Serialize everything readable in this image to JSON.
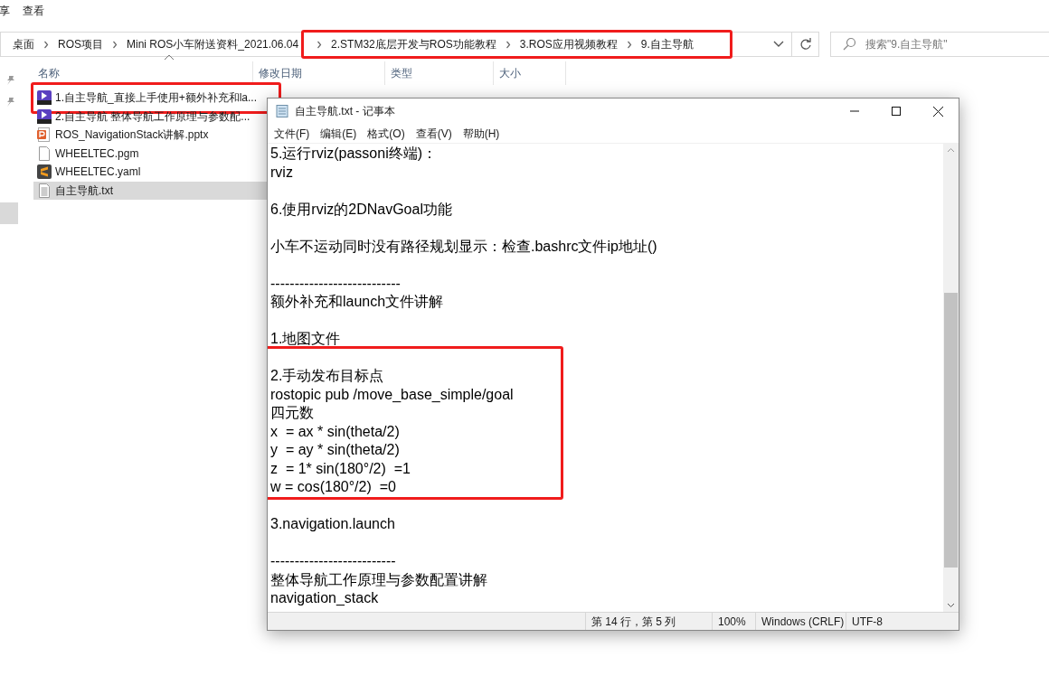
{
  "ribbon": {
    "tabs": [
      "享",
      "查看"
    ]
  },
  "address": {
    "crumb_groups": [
      {
        "highlighted": false,
        "crumbs": [
          "桌面",
          "ROS项目",
          "Mini ROS小车附送资料_2021.06.04"
        ]
      },
      {
        "highlighted": true,
        "crumbs": [
          "2.STM32底层开发与ROS功能教程",
          "3.ROS应用视频教程",
          "9.自主导航"
        ]
      }
    ],
    "search_placeholder": "搜索\"9.自主导航\""
  },
  "columns": [
    "名称",
    "修改日期",
    "类型",
    "大小"
  ],
  "files": [
    {
      "kind": "video",
      "name": "1.自主导航_直接上手使用+额外补充和la...",
      "selected": false,
      "highlighted": true
    },
    {
      "kind": "video",
      "name": "2.自主导航 整体导航工作原理与参数配...",
      "selected": false,
      "highlighted": false
    },
    {
      "kind": "slides",
      "name": "ROS_NavigationStack讲解.pptx",
      "selected": false,
      "highlighted": false
    },
    {
      "kind": "blank",
      "name": "WHEELTEC.pgm",
      "selected": false,
      "highlighted": false
    },
    {
      "kind": "sublime",
      "name": "WHEELTEC.yaml",
      "selected": false,
      "highlighted": false
    },
    {
      "kind": "text",
      "name": "自主导航.txt",
      "selected": true,
      "highlighted": false
    }
  ],
  "notepad": {
    "title": "自主导航.txt - 记事本",
    "menu": [
      "文件(F)",
      "编辑(E)",
      "格式(O)",
      "查看(V)",
      "帮助(H)"
    ],
    "blocks": [
      {
        "highlighted": false,
        "lines": [
          "5.运行rviz(passoni终端)：",
          "rviz"
        ]
      },
      {
        "highlighted": false,
        "lines": [
          "6.使用rviz的2DNavGoal功能"
        ]
      },
      {
        "highlighted": false,
        "lines": [
          "小车不运动同时没有路径规划显示：检查.bashrc文件ip地址()"
        ]
      },
      {
        "highlighted": false,
        "lines": [
          "---------------------------",
          "额外补充和launch文件讲解"
        ]
      },
      {
        "highlighted": false,
        "lines": [
          "1.地图文件"
        ]
      },
      {
        "highlighted": true,
        "lines": [
          "2.手动发布目标点",
          "rostopic pub /move_base_simple/goal",
          "四元数",
          "x  = ax * sin(theta/2)",
          "y  = ay * sin(theta/2)",
          "z  = 1* sin(180°/2)  =1",
          "w = cos(180°/2)  =0"
        ]
      },
      {
        "highlighted": false,
        "lines": [
          "3.navigation.launch"
        ]
      },
      {
        "highlighted": false,
        "lines": [
          "--------------------------",
          "整体导航工作原理与参数配置讲解",
          "navigation_stack"
        ]
      }
    ],
    "status": [
      "第 14 行，第 5 列",
      "100%",
      "Windows (CRLF)",
      "UTF-8"
    ]
  }
}
